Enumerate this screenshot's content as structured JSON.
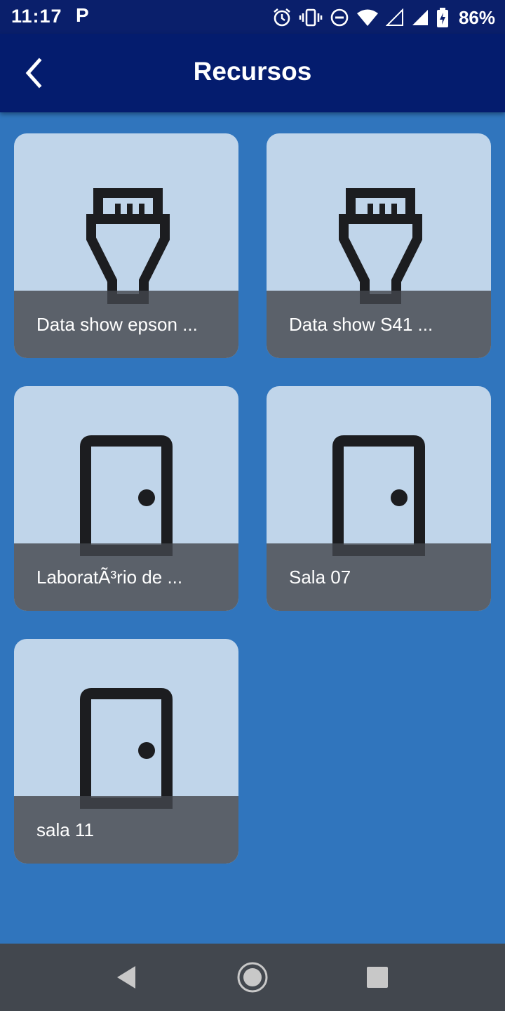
{
  "status_bar": {
    "time": "11:17",
    "notification_app_letter": "P",
    "battery_percent": "86%",
    "icons": [
      "alarm-icon",
      "vibrate-icon",
      "do-not-disturb-icon",
      "wifi-icon",
      "signal-empty-icon",
      "signal-full-icon",
      "battery-charging-icon"
    ]
  },
  "app_bar": {
    "title": "Recursos",
    "back_icon": "chevron-left-icon"
  },
  "resources": [
    {
      "label": "Data show epson ...",
      "icon": "hdmi-connector-icon"
    },
    {
      "label": "Data show S41 ...",
      "icon": "hdmi-connector-icon"
    },
    {
      "label": "LaboratÃ³rio de ...",
      "icon": "door-icon"
    },
    {
      "label": "Sala 07",
      "icon": "door-icon"
    },
    {
      "label": "sala 11",
      "icon": "door-icon"
    }
  ],
  "colors": {
    "status_bar": "#0a1f6b",
    "app_bar": "#041c6e",
    "background": "#3075bd",
    "card": "#c0d5ea",
    "card_footer": "#5b616a",
    "nav_bar": "#42474e"
  },
  "nav_bar": {
    "buttons": [
      "back-triangle-icon",
      "home-circle-icon",
      "recents-square-icon"
    ]
  }
}
